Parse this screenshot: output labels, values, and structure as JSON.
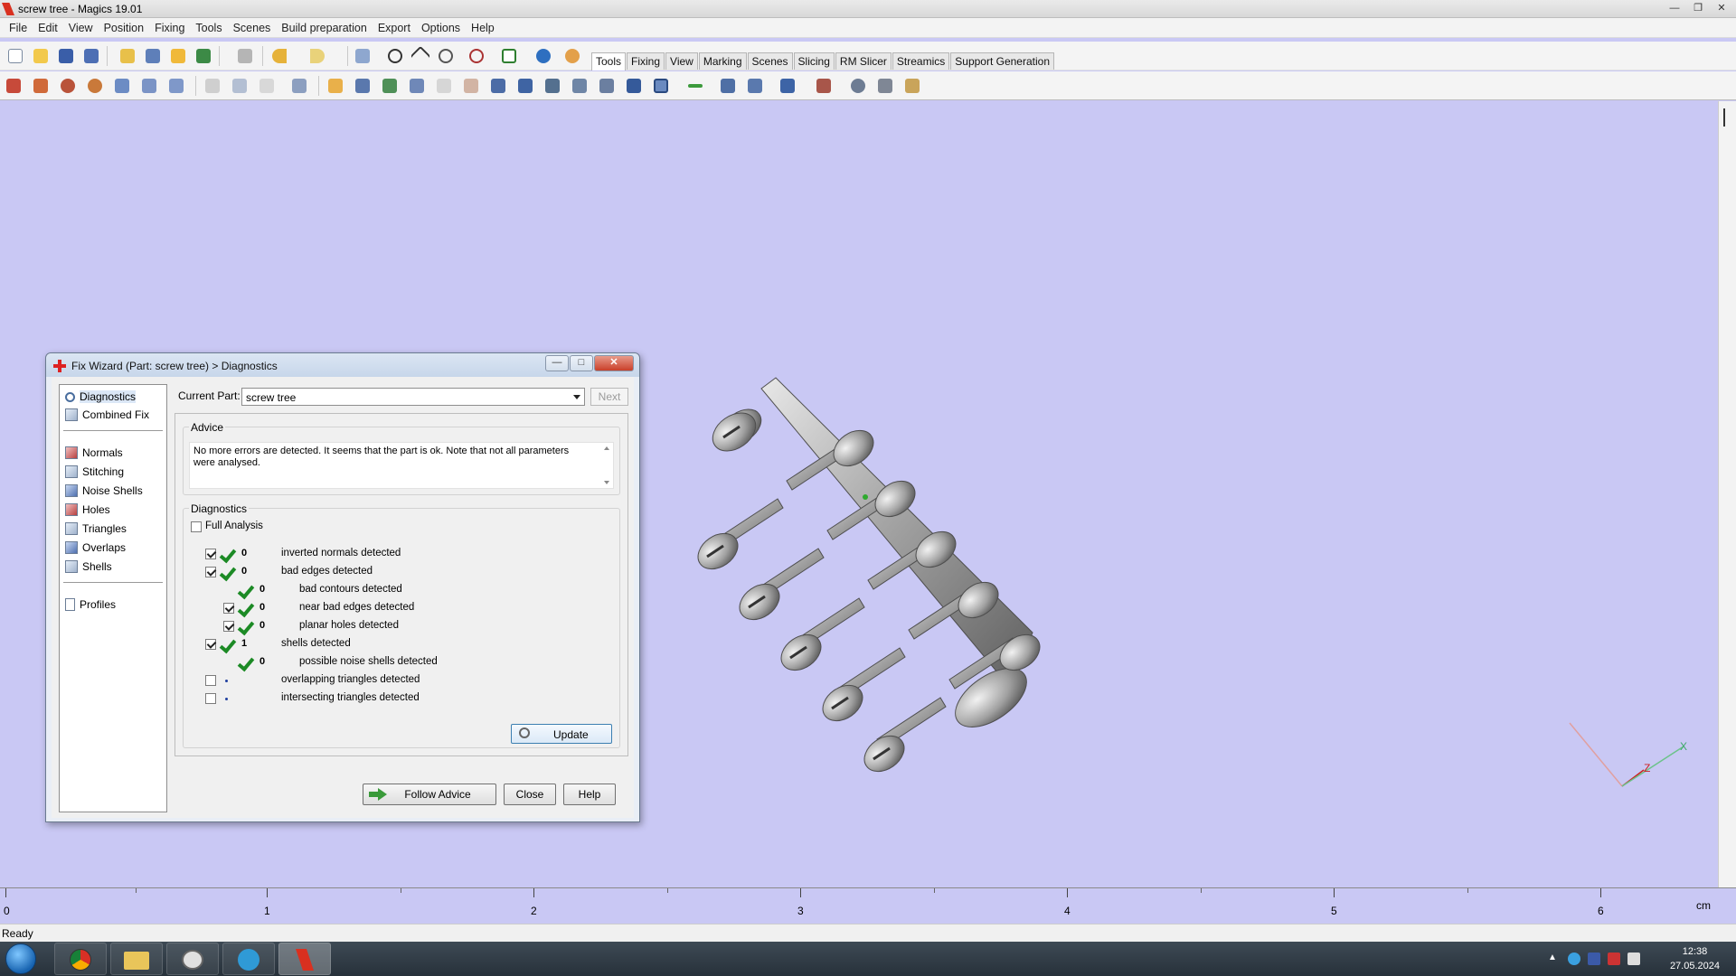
{
  "window": {
    "title": "screw tree - Magics 19.01"
  },
  "menu": [
    "File",
    "Edit",
    "View",
    "Position",
    "Fixing",
    "Tools",
    "Scenes",
    "Build preparation",
    "Export",
    "Options",
    "Help"
  ],
  "toolbar_tabs": [
    "Tools",
    "Fixing",
    "View",
    "Marking",
    "Scenes",
    "Slicing",
    "RM Slicer",
    "Streamics",
    "Support Generation"
  ],
  "active_tab": "Tools",
  "dialog": {
    "title": "Fix Wizard (Part: screw tree) > Diagnostics",
    "nav": {
      "top": [
        "Diagnostics",
        "Combined Fix"
      ],
      "tools": [
        "Normals",
        "Stitching",
        "Noise Shells",
        "Holes",
        "Triangles",
        "Overlaps",
        "Shells"
      ],
      "bottom": [
        "Profiles"
      ]
    },
    "current_part_label": "Current Part:",
    "current_part_value": "screw tree",
    "next_label": "Next",
    "advice": {
      "legend": "Advice",
      "text": "No more errors are detected. It seems that the part is ok. Note that not all parameters were analysed."
    },
    "diagnostics": {
      "legend": "Diagnostics",
      "full_analysis_label": "Full Analysis",
      "rows": [
        {
          "checked": true,
          "status": "ok",
          "count": "0",
          "label": "inverted normals detected",
          "indent": 0,
          "has_checkbox": true
        },
        {
          "checked": true,
          "status": "ok",
          "count": "0",
          "label": "bad edges detected",
          "indent": 0,
          "has_checkbox": true
        },
        {
          "checked": false,
          "status": "ok",
          "count": "0",
          "label": "bad contours detected",
          "indent": 1,
          "has_checkbox": false
        },
        {
          "checked": true,
          "status": "ok",
          "count": "0",
          "label": "near bad edges detected",
          "indent": 1,
          "has_checkbox": true
        },
        {
          "checked": true,
          "status": "ok",
          "count": "0",
          "label": "planar holes detected",
          "indent": 1,
          "has_checkbox": true
        },
        {
          "checked": true,
          "status": "ok",
          "count": "1",
          "label": "shells detected",
          "indent": 0,
          "has_checkbox": true
        },
        {
          "checked": false,
          "status": "ok",
          "count": "0",
          "label": "possible noise shells detected",
          "indent": 1,
          "has_checkbox": false
        },
        {
          "checked": false,
          "status": "dot",
          "count": "",
          "label": "overlapping triangles detected",
          "indent": 0,
          "has_checkbox": true
        },
        {
          "checked": false,
          "status": "dot",
          "count": "",
          "label": "intersecting triangles detected",
          "indent": 0,
          "has_checkbox": true
        }
      ],
      "update_label": "Update"
    },
    "buttons": {
      "follow_advice": "Follow Advice",
      "close": "Close",
      "help": "Help"
    }
  },
  "ruler": {
    "unit": "cm",
    "labels": [
      "0",
      "1",
      "2",
      "3",
      "4",
      "5",
      "6"
    ]
  },
  "axes_labels": {
    "z": "Z",
    "x": "X"
  },
  "status": {
    "text": "Ready"
  },
  "clock": {
    "time": "12:38",
    "date": "27.05.2024"
  }
}
